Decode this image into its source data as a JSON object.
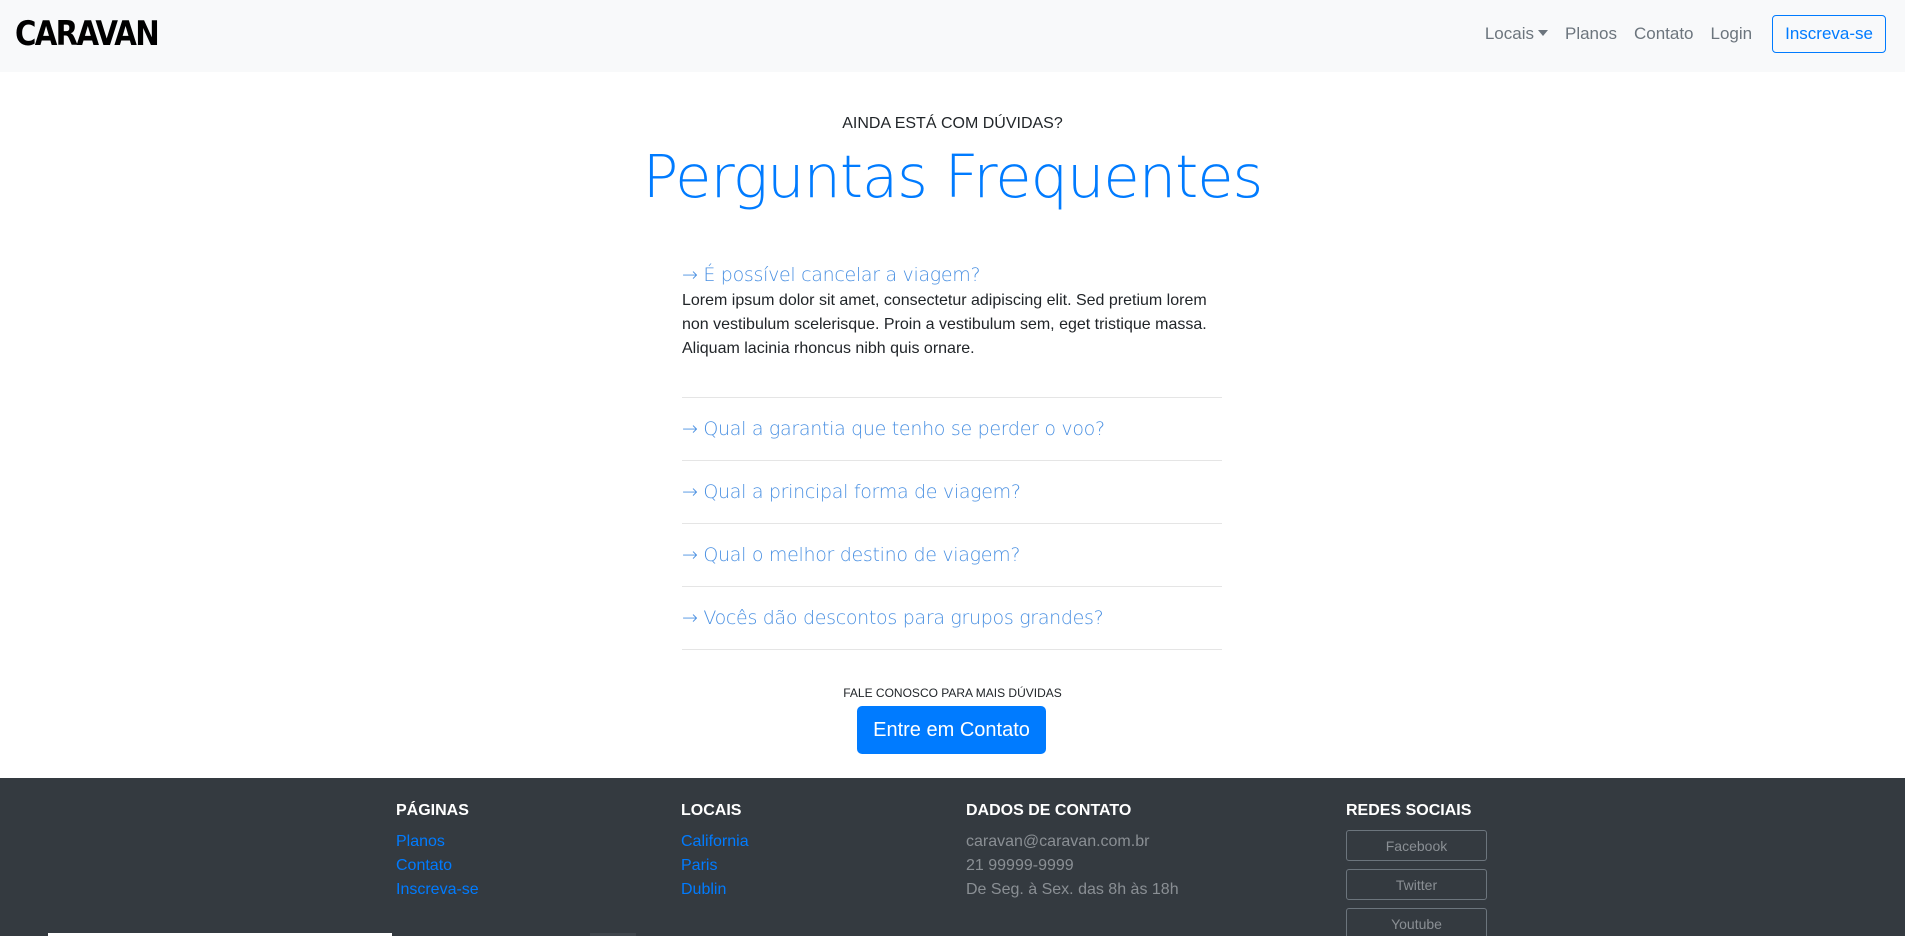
{
  "header": {
    "brand": "CARAVAN",
    "nav": [
      {
        "label": "Locais"
      },
      {
        "label": "Planos"
      },
      {
        "label": "Contato"
      },
      {
        "label": "Login"
      }
    ],
    "signup_label": "Inscreva-se"
  },
  "main": {
    "eyebrow": "AINDA ESTÁ COM DÚVIDAS?",
    "title": "Perguntas Frequentes",
    "faq": [
      {
        "question": "→ É possível cancelar a viagem?",
        "answer": "Lorem ipsum dolor sit amet, consectetur adipiscing elit. Sed pretium lorem non vestibulum scelerisque. Proin a vestibulum sem, eget tristique massa. Aliquam lacinia rhoncus nibh quis ornare."
      },
      {
        "question": "→ Qual a garantia que tenho se perder o voo?"
      },
      {
        "question": "→ Qual a principal forma de viagem?"
      },
      {
        "question": "→ Qual o melhor destino de viagem?"
      },
      {
        "question": "→ Vocês dão descontos para grupos grandes?"
      }
    ],
    "cta_text": "FALE CONOSCO PARA MAIS DÚVIDAS",
    "cta_button": "Entre em Contato"
  },
  "footer": {
    "pages": {
      "heading": "PÁGINAS",
      "links": [
        "Planos",
        "Contato",
        "Inscreva-se"
      ]
    },
    "locations": {
      "heading": "LOCAIS",
      "links": [
        "California",
        "Paris",
        "Dublin"
      ]
    },
    "contact": {
      "heading": "DADOS DE CONTATO",
      "email": "caravan@caravan.com.br",
      "phone": "21 99999-9999",
      "hours": "De Seg. à Sex. das 8h às 18h"
    },
    "social": {
      "heading": "REDES SOCIAIS",
      "buttons": [
        "Facebook",
        "Twitter",
        "Youtube"
      ]
    }
  },
  "colors": {
    "accent": "#007bff",
    "navbar_bg": "#f8f9fa",
    "footer_bg": "#343a40"
  }
}
